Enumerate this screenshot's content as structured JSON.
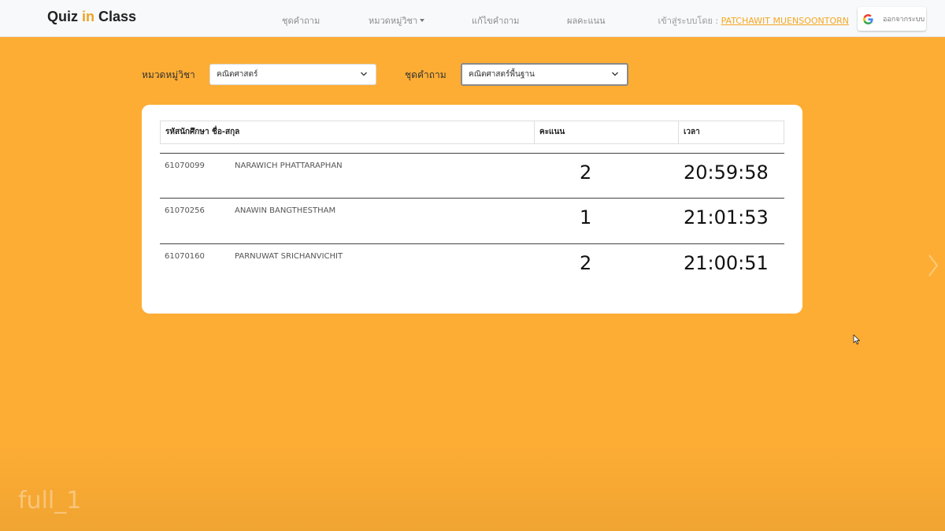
{
  "navbar": {
    "brand_part1": "Quiz ",
    "brand_accent": "in",
    "brand_part2": " Class",
    "links": {
      "question_sets": "ชุดคำถาม",
      "categories": "หมวดหมู่วิชา",
      "edit_questions": "แก้ไขคำถาม",
      "scores": "ผลคะแนน"
    },
    "login_prefix": "เข้าสู่ระบบโดย : ",
    "login_user": "PATCHAWIT MUENSOONTORN",
    "logout_label": "ออกจากระบบ"
  },
  "filters": {
    "category_label": "หมวดหมู่วิชา",
    "category_value": "คณิตศาสตร์",
    "set_label": "ชุดคำถาม",
    "set_value": "คณิตศาสตร์พื้นฐาน"
  },
  "table": {
    "headers": {
      "id_name": "รหัสนักศึกษา ชื่อ-สกุล",
      "score": "คะแนน",
      "time": "เวลา"
    },
    "rows": [
      {
        "id": "61070099",
        "name": "NARAWICH PHATTARAPHAN",
        "score": "2",
        "time": "20:59:58"
      },
      {
        "id": "61070256",
        "name": "ANAWIN BANGTHESTHAM",
        "score": "1",
        "time": "21:01:53"
      },
      {
        "id": "61070160",
        "name": "PARNUWAT SRICHANVICHIT",
        "score": "2",
        "time": "21:00:51"
      }
    ]
  },
  "watermark": "full_1",
  "icons": {
    "google": "google-g-icon",
    "chevron": "chevron-down-icon",
    "next": "chevron-right-icon",
    "cursor": "mouse-cursor-icon"
  },
  "colors": {
    "background": "#fdad34",
    "brand_accent": "#f0a224",
    "user_link": "#f5a623"
  }
}
